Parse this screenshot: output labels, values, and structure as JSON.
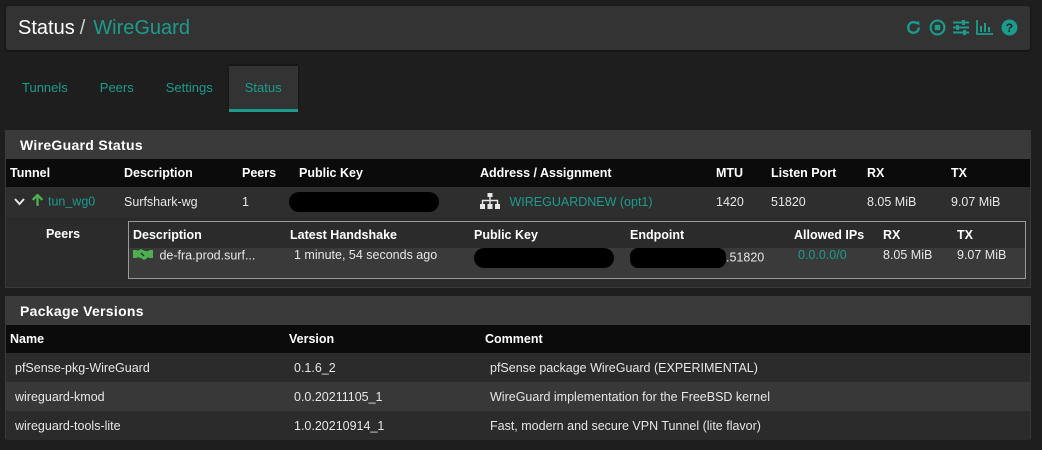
{
  "header": {
    "crumb_status": "Status",
    "separator": "/",
    "crumb_wireguard": "WireGuard",
    "icons": [
      "reload-icon",
      "stop-icon",
      "settings-icon",
      "chart-icon",
      "help-icon"
    ]
  },
  "tabs": [
    {
      "label": "Tunnels",
      "active": false
    },
    {
      "label": "Peers",
      "active": false
    },
    {
      "label": "Settings",
      "active": false
    },
    {
      "label": "Status",
      "active": true
    }
  ],
  "status_panel": {
    "title": "WireGuard Status",
    "columns": [
      "Tunnel",
      "Description",
      "Peers",
      "Public Key",
      "Address / Assignment",
      "MTU",
      "Listen Port",
      "RX",
      "TX"
    ],
    "tunnel": {
      "name": "tun_wg0",
      "description": "Surfshark-wg",
      "peers": "1",
      "assignment": "WIREGUARDNEW (opt1)",
      "mtu": "1420",
      "listen_port": "51820",
      "rx": "8.05 MiB",
      "tx": "9.07 MiB"
    },
    "peers_label": "Peers",
    "peer_columns": [
      "Description",
      "Latest Handshake",
      "Public Key",
      "Endpoint",
      "Allowed IPs",
      "RX",
      "TX"
    ],
    "peer": {
      "description": "de-fra.prod.surf...",
      "handshake": "1 minute, 54 seconds ago",
      "endpoint_suffix": ".51820",
      "allowed_ips": "0.0.0.0/0",
      "rx": "8.05 MiB",
      "tx": "9.07 MiB"
    }
  },
  "package_panel": {
    "title": "Package Versions",
    "columns": [
      "Name",
      "Version",
      "Comment"
    ],
    "rows": [
      {
        "name": "pfSense-pkg-WireGuard",
        "version": "0.1.6_2",
        "comment": "pfSense package WireGuard (EXPERIMENTAL)"
      },
      {
        "name": "wireguard-kmod",
        "version": "0.0.20211105_1",
        "comment": "WireGuard implementation for the FreeBSD kernel"
      },
      {
        "name": "wireguard-tools-lite",
        "version": "1.0.20210914_1",
        "comment": "Fast, modern and secure VPN Tunnel (lite flavor)"
      }
    ]
  },
  "colors": {
    "accent": "#1a9c8c",
    "background": "#1e1e1e",
    "panel": "#2b2b2b",
    "header_row": "#0b0b0b",
    "online": "#4caf50"
  }
}
